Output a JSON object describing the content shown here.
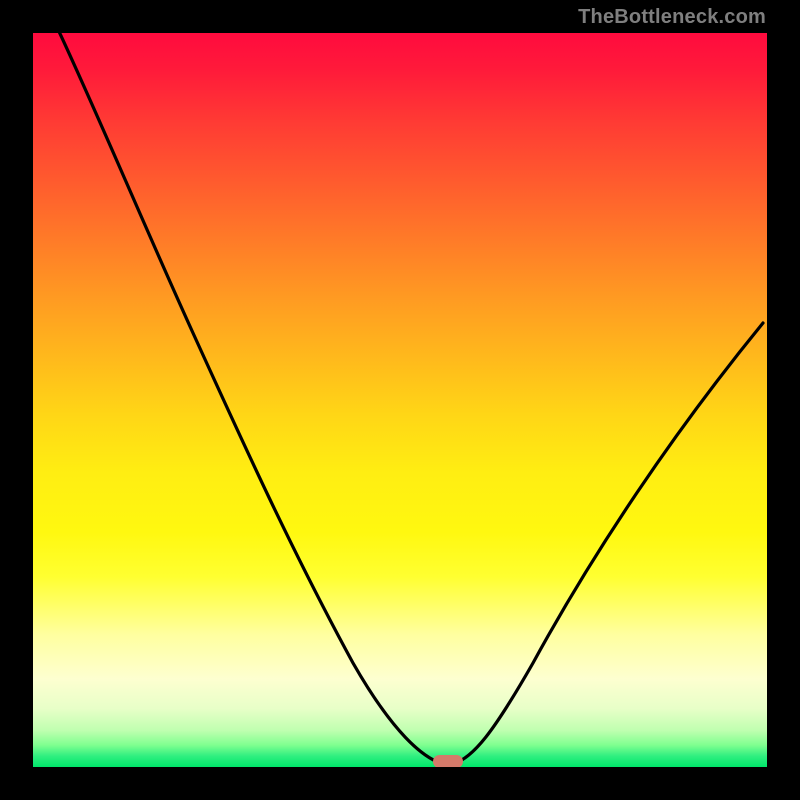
{
  "watermark": "TheBottleneck.com",
  "chart_data": {
    "type": "line",
    "title": "",
    "xlabel": "",
    "ylabel": "",
    "xlim": [
      0,
      100
    ],
    "ylim": [
      0,
      100
    ],
    "series": [
      {
        "name": "bottleneck-curve",
        "x": [
          0,
          5,
          10,
          15,
          20,
          25,
          30,
          35,
          40,
          45,
          50,
          52,
          54,
          56,
          58,
          60,
          62,
          66,
          70,
          75,
          80,
          85,
          90,
          95,
          100
        ],
        "values": [
          100,
          93,
          85,
          76,
          67,
          58,
          48,
          38,
          28,
          18,
          8,
          4,
          1,
          0,
          1,
          4,
          8,
          16,
          24,
          32,
          40,
          47,
          53,
          58,
          62
        ]
      }
    ],
    "marker": {
      "x": 56,
      "width": 4,
      "height": 2,
      "color": "#d47a6a"
    },
    "background": "heatmap-gradient-red-to-green"
  }
}
